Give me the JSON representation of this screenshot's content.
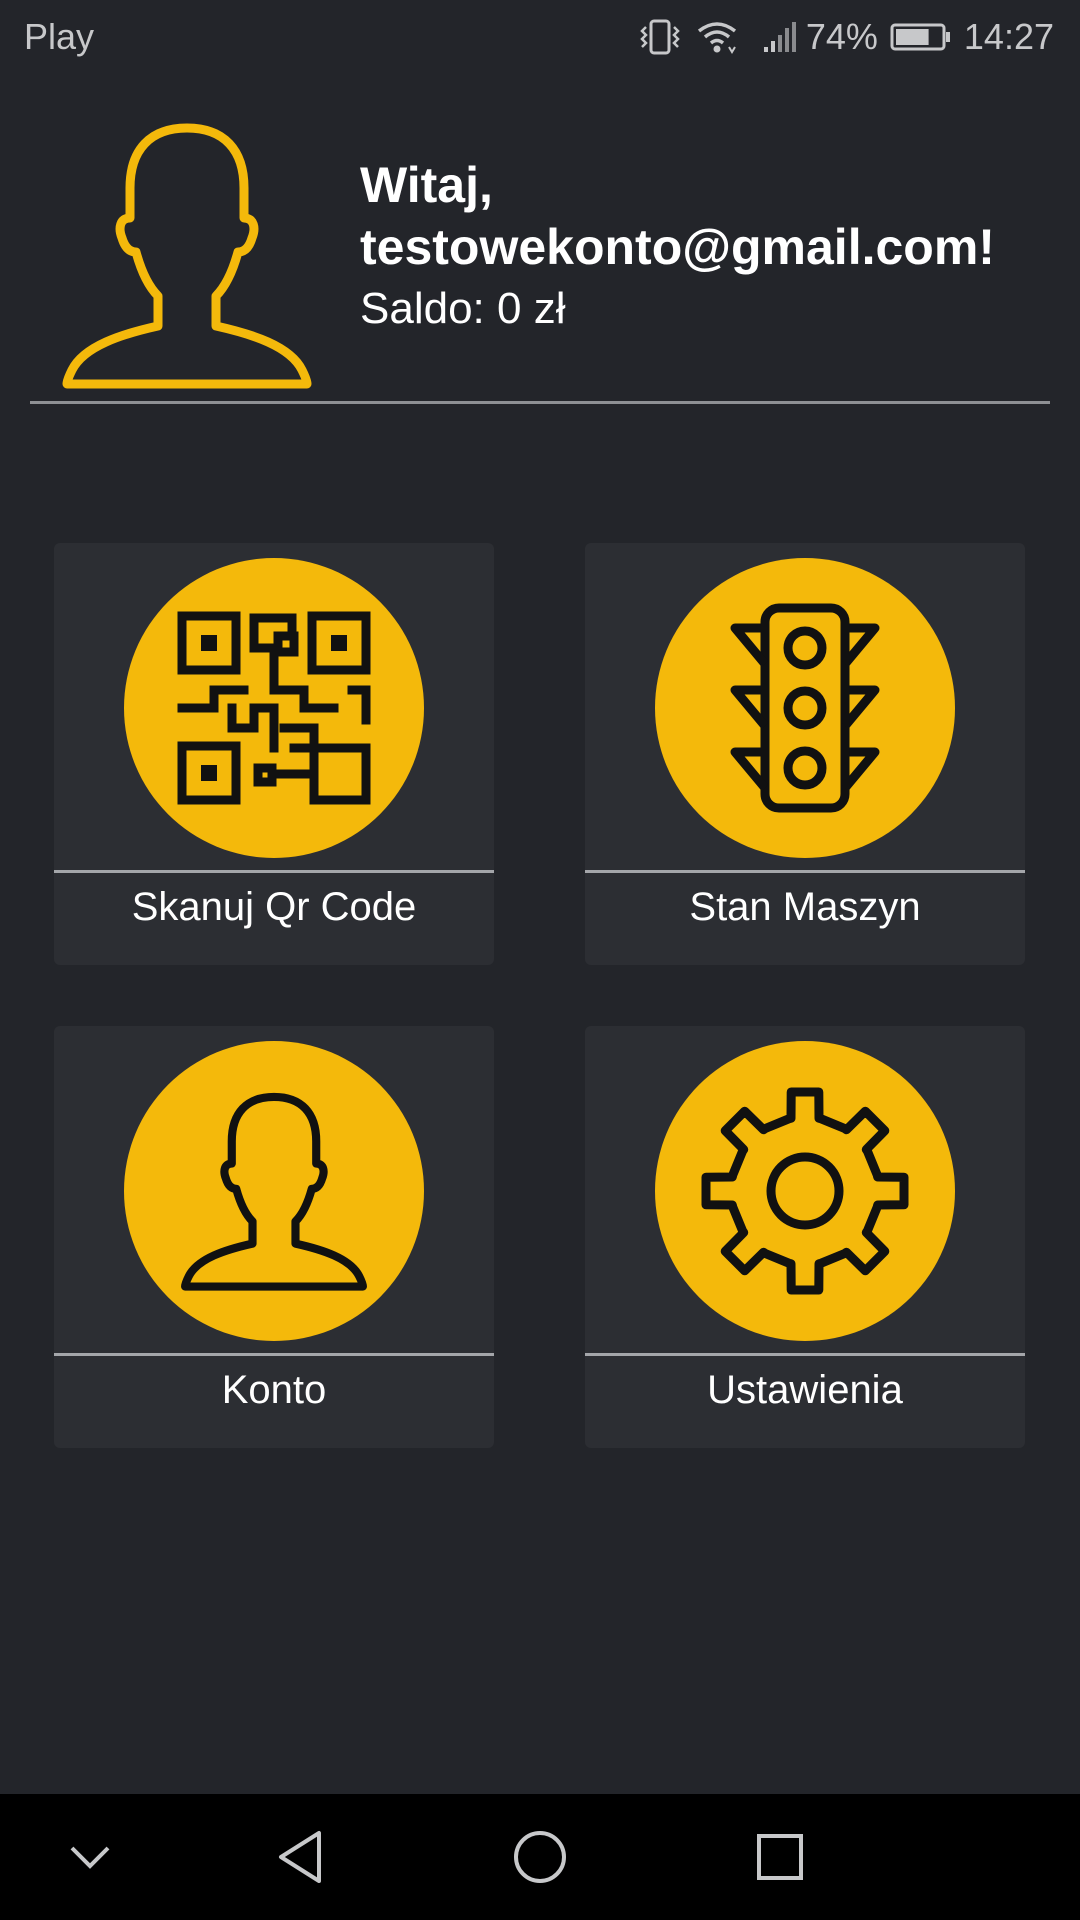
{
  "status_bar": {
    "carrier": "Play",
    "battery_percent": "74%",
    "time": "14:27",
    "battery_level": 0.74,
    "icons": [
      "vibrate-icon",
      "wifi-icon",
      "signal-icon",
      "battery-icon"
    ]
  },
  "header": {
    "greeting_line1": "Witaj,",
    "greeting_line2": "testowekonto@gmail.com!",
    "balance_label": "Saldo:",
    "balance_value": "0 zł",
    "avatar_icon": "user-silhouette-icon"
  },
  "tiles": [
    {
      "label": "Skanuj Qr Code",
      "icon": "qr-code-icon"
    },
    {
      "label": "Stan Maszyn",
      "icon": "traffic-light-icon"
    },
    {
      "label": "Konto",
      "icon": "user-icon"
    },
    {
      "label": "Ustawienia",
      "icon": "gear-icon"
    }
  ],
  "nav_bar": {
    "buttons": [
      "hide-keyboard-icon",
      "back-icon",
      "home-icon",
      "recent-apps-icon"
    ]
  },
  "colors": {
    "background": "#23252a",
    "tile": "#2c2e33",
    "accent": "#f4b90b",
    "text": "#ffffff",
    "status_text": "#c7c8ca",
    "nav_bar": "#000000"
  }
}
